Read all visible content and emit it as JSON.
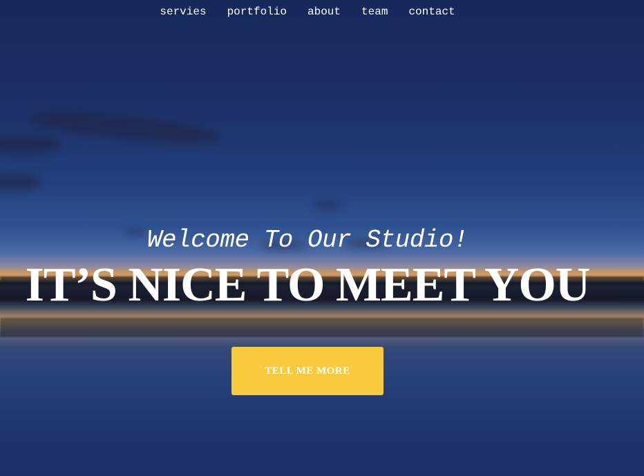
{
  "nav": {
    "items": [
      {
        "label": "servies"
      },
      {
        "label": "portfolio"
      },
      {
        "label": "about"
      },
      {
        "label": "team"
      },
      {
        "label": "contact"
      }
    ]
  },
  "hero": {
    "subtitle": "Welcome To Our Studio!",
    "headline": "IT’S NICE TO MEET YOU",
    "cta_label": "TELL ME MORE"
  },
  "colors": {
    "cta_background": "#f7cb3c",
    "text": "#ffffff",
    "sky_top": "#16285a"
  }
}
